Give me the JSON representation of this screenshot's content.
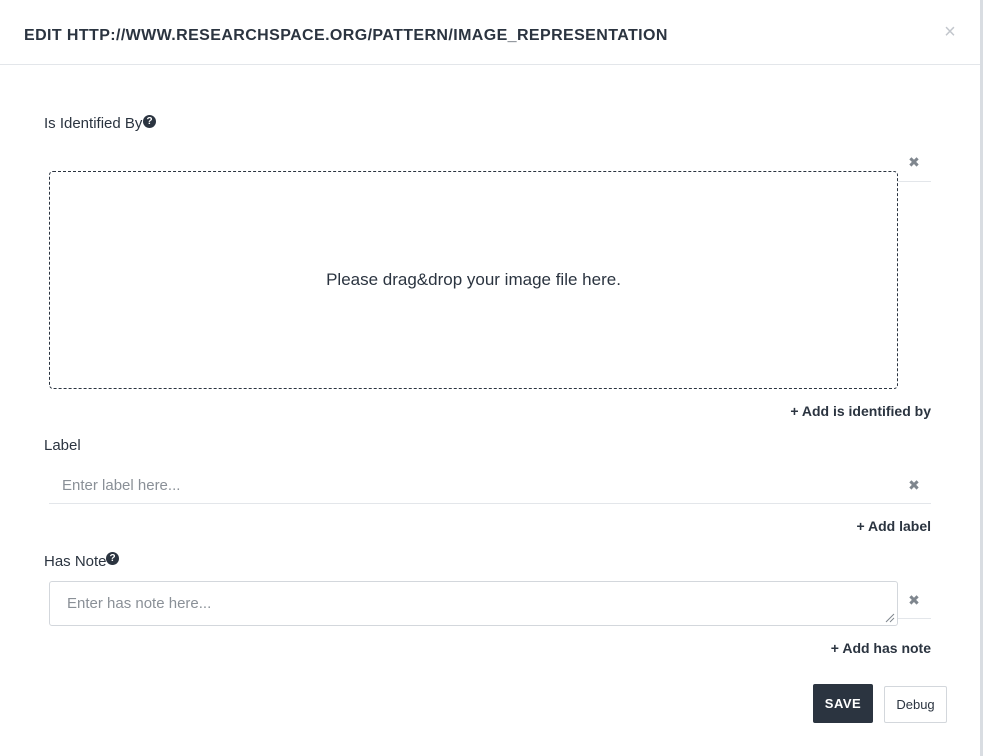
{
  "modal": {
    "title": "EDIT HTTP://WWW.RESEARCHSPACE.ORG/PATTERN/IMAGE_REPRESENTATION",
    "close_glyph": "×"
  },
  "fields": {
    "is_identified_by": {
      "label": "Is Identified By",
      "dropzone_text": "Please drag&drop your image file here.",
      "add_label": "+ Add is identified by"
    },
    "label": {
      "label": "Label",
      "placeholder": "Enter label here...",
      "add_label": "+ Add label"
    },
    "has_note": {
      "label": "Has Note",
      "placeholder": "Enter has note here...",
      "add_label": "+ Add has note"
    }
  },
  "icons": {
    "help": "question-circle-icon",
    "remove": "remove-x-icon",
    "close": "close-icon"
  },
  "actions": {
    "save_label": "SAVE",
    "debug_label": "Debug"
  },
  "colors": {
    "primary": "#2b3440",
    "border": "#d3d7dc",
    "muted": "#8a9097"
  }
}
